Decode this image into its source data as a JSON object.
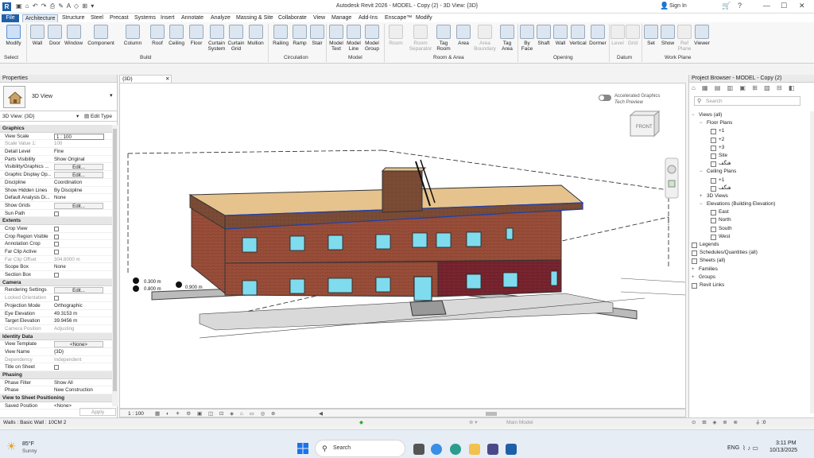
{
  "window": {
    "title": "Autodesk Revit 2026 - MODEL - Copy (2) - 3D View: {3D}",
    "sign_in": "Sign In"
  },
  "tabs": [
    "File",
    "Architecture",
    "Structure",
    "Steel",
    "Precast",
    "Systems",
    "Insert",
    "Annotate",
    "Analyze",
    "Massing & Site",
    "Collaborate",
    "View",
    "Manage",
    "Add-Ins",
    "Enscape™",
    "Modify"
  ],
  "ribbon": {
    "buttons": [
      "Modify",
      "Wall",
      "Door",
      "Window",
      "Component",
      "Column",
      "Roof",
      "Ceiling",
      "Floor",
      "Curtain System",
      "Curtain Grid",
      "Mullion",
      "Railing",
      "Ramp",
      "Stair",
      "Model Text",
      "Model Line",
      "Model Group",
      "Room",
      "Room Separator",
      "Tag Room",
      "Area",
      "Area Boundary",
      "Tag Area",
      "By Face",
      "Shaft",
      "Wall",
      "Vertical",
      "Dormer",
      "Level",
      "Grid",
      "Set",
      "Show",
      "Ref Plane",
      "Viewer"
    ],
    "panels": [
      "Select",
      "Build",
      "Circulation",
      "Model",
      "Room & Area",
      "Opening",
      "Datum",
      "Work Plane"
    ]
  },
  "properties": {
    "title": "Properties",
    "type_name": "3D View",
    "filter": "3D View: {3D}",
    "edit_type": "Edit Type",
    "apply": "Apply",
    "groups": [
      {
        "name": "Graphics",
        "rows": [
          [
            "View Scale",
            "1 : 100"
          ],
          [
            "Scale Value    1:",
            "100"
          ],
          [
            "Detail Level",
            "Fine"
          ],
          [
            "Parts Visibility",
            "Show Original"
          ],
          [
            "Visibility/Graphics ...",
            "Edit..."
          ],
          [
            "Graphic Display Op...",
            "Edit..."
          ],
          [
            "Discipline",
            "Coordination"
          ],
          [
            "Show Hidden Lines",
            "By Discipline"
          ],
          [
            "Default Analysis Di...",
            "None"
          ],
          [
            "Show Grids",
            "Edit..."
          ],
          [
            "Sun Path",
            ""
          ]
        ]
      },
      {
        "name": "Extents",
        "rows": [
          [
            "Crop View",
            ""
          ],
          [
            "Crop Region Visible",
            ""
          ],
          [
            "Annotation Crop",
            ""
          ],
          [
            "Far Clip Active",
            ""
          ],
          [
            "Far Clip Offset",
            "304.8000 m"
          ],
          [
            "Scope Box",
            "None"
          ],
          [
            "Section Box",
            ""
          ]
        ]
      },
      {
        "name": "Camera",
        "rows": [
          [
            "Rendering Settings",
            "Edit..."
          ],
          [
            "Locked Orientation",
            ""
          ],
          [
            "Projection Mode",
            "Orthographic"
          ],
          [
            "Eye Elevation",
            "49.3153 m"
          ],
          [
            "Target Elevation",
            "39.9456 m"
          ],
          [
            "Camera Position",
            "Adjusting"
          ]
        ]
      },
      {
        "name": "Identity Data",
        "rows": [
          [
            "View Template",
            "<None>"
          ],
          [
            "View Name",
            "{3D}"
          ],
          [
            "Dependency",
            "Independent"
          ],
          [
            "Title on Sheet",
            ""
          ]
        ]
      },
      {
        "name": "Phasing",
        "rows": [
          [
            "Phase Filter",
            "Show All"
          ],
          [
            "Phase",
            "New Construction"
          ]
        ]
      },
      {
        "name": "View to Sheet Positioning",
        "rows": [
          [
            "Saved Position",
            "<None>"
          ]
        ]
      }
    ]
  },
  "view": {
    "tab": "{3D}",
    "accel_line1": "Accelerated Graphics",
    "accel_line2": "Tech Preview",
    "cube_face": "FRONT",
    "dim1": "0.300 m",
    "dim2": "0.800 m",
    "dim3": "0.900 m",
    "scale": "1 : 100",
    "model": "Main Model"
  },
  "browser": {
    "title": "Project Browser - MODEL - Copy (2)",
    "search": "Search",
    "tree": [
      {
        "t": "Views (all)",
        "lv": 0,
        "g": "−"
      },
      {
        "t": "Floor Plans",
        "lv": 1,
        "g": "−"
      },
      {
        "t": "+1",
        "lv": 2,
        "i": 1
      },
      {
        "t": "+2",
        "lv": 2,
        "i": 1
      },
      {
        "t": "+3",
        "lv": 2,
        "i": 1
      },
      {
        "t": "Site",
        "lv": 2,
        "i": 1
      },
      {
        "t": "هنگف",
        "lv": 2,
        "i": 1
      },
      {
        "t": "Ceiling Plans",
        "lv": 1,
        "g": "−"
      },
      {
        "t": "+1",
        "lv": 2,
        "i": 1
      },
      {
        "t": "هنگف",
        "lv": 2,
        "i": 1
      },
      {
        "t": "3D Views",
        "lv": 1,
        "g": "+"
      },
      {
        "t": "Elevations (Building Elevation)",
        "lv": 1,
        "g": "−"
      },
      {
        "t": "East",
        "lv": 2,
        "i": 1
      },
      {
        "t": "North",
        "lv": 2,
        "i": 1
      },
      {
        "t": "South",
        "lv": 2,
        "i": 1
      },
      {
        "t": "West",
        "lv": 2,
        "i": 1
      },
      {
        "t": "Legends",
        "lv": 0,
        "i": 1
      },
      {
        "t": "Schedules/Quantities (all)",
        "lv": 0,
        "i": 1
      },
      {
        "t": "Sheets (all)",
        "lv": 0,
        "i": 1
      },
      {
        "t": "Families",
        "lv": 0,
        "g": "+"
      },
      {
        "t": "Groups",
        "lv": 0,
        "g": "+"
      },
      {
        "t": "Revit Links",
        "lv": 0,
        "i": 1
      }
    ]
  },
  "status": {
    "text": "Walls : Basic Wall : 10CM 2",
    "filter": ":0"
  },
  "taskbar": {
    "temp": "85°F",
    "weather": "Sunny",
    "search": "Search",
    "lang": "ENG",
    "time": "3:11 PM",
    "date": "10/13/2025"
  }
}
